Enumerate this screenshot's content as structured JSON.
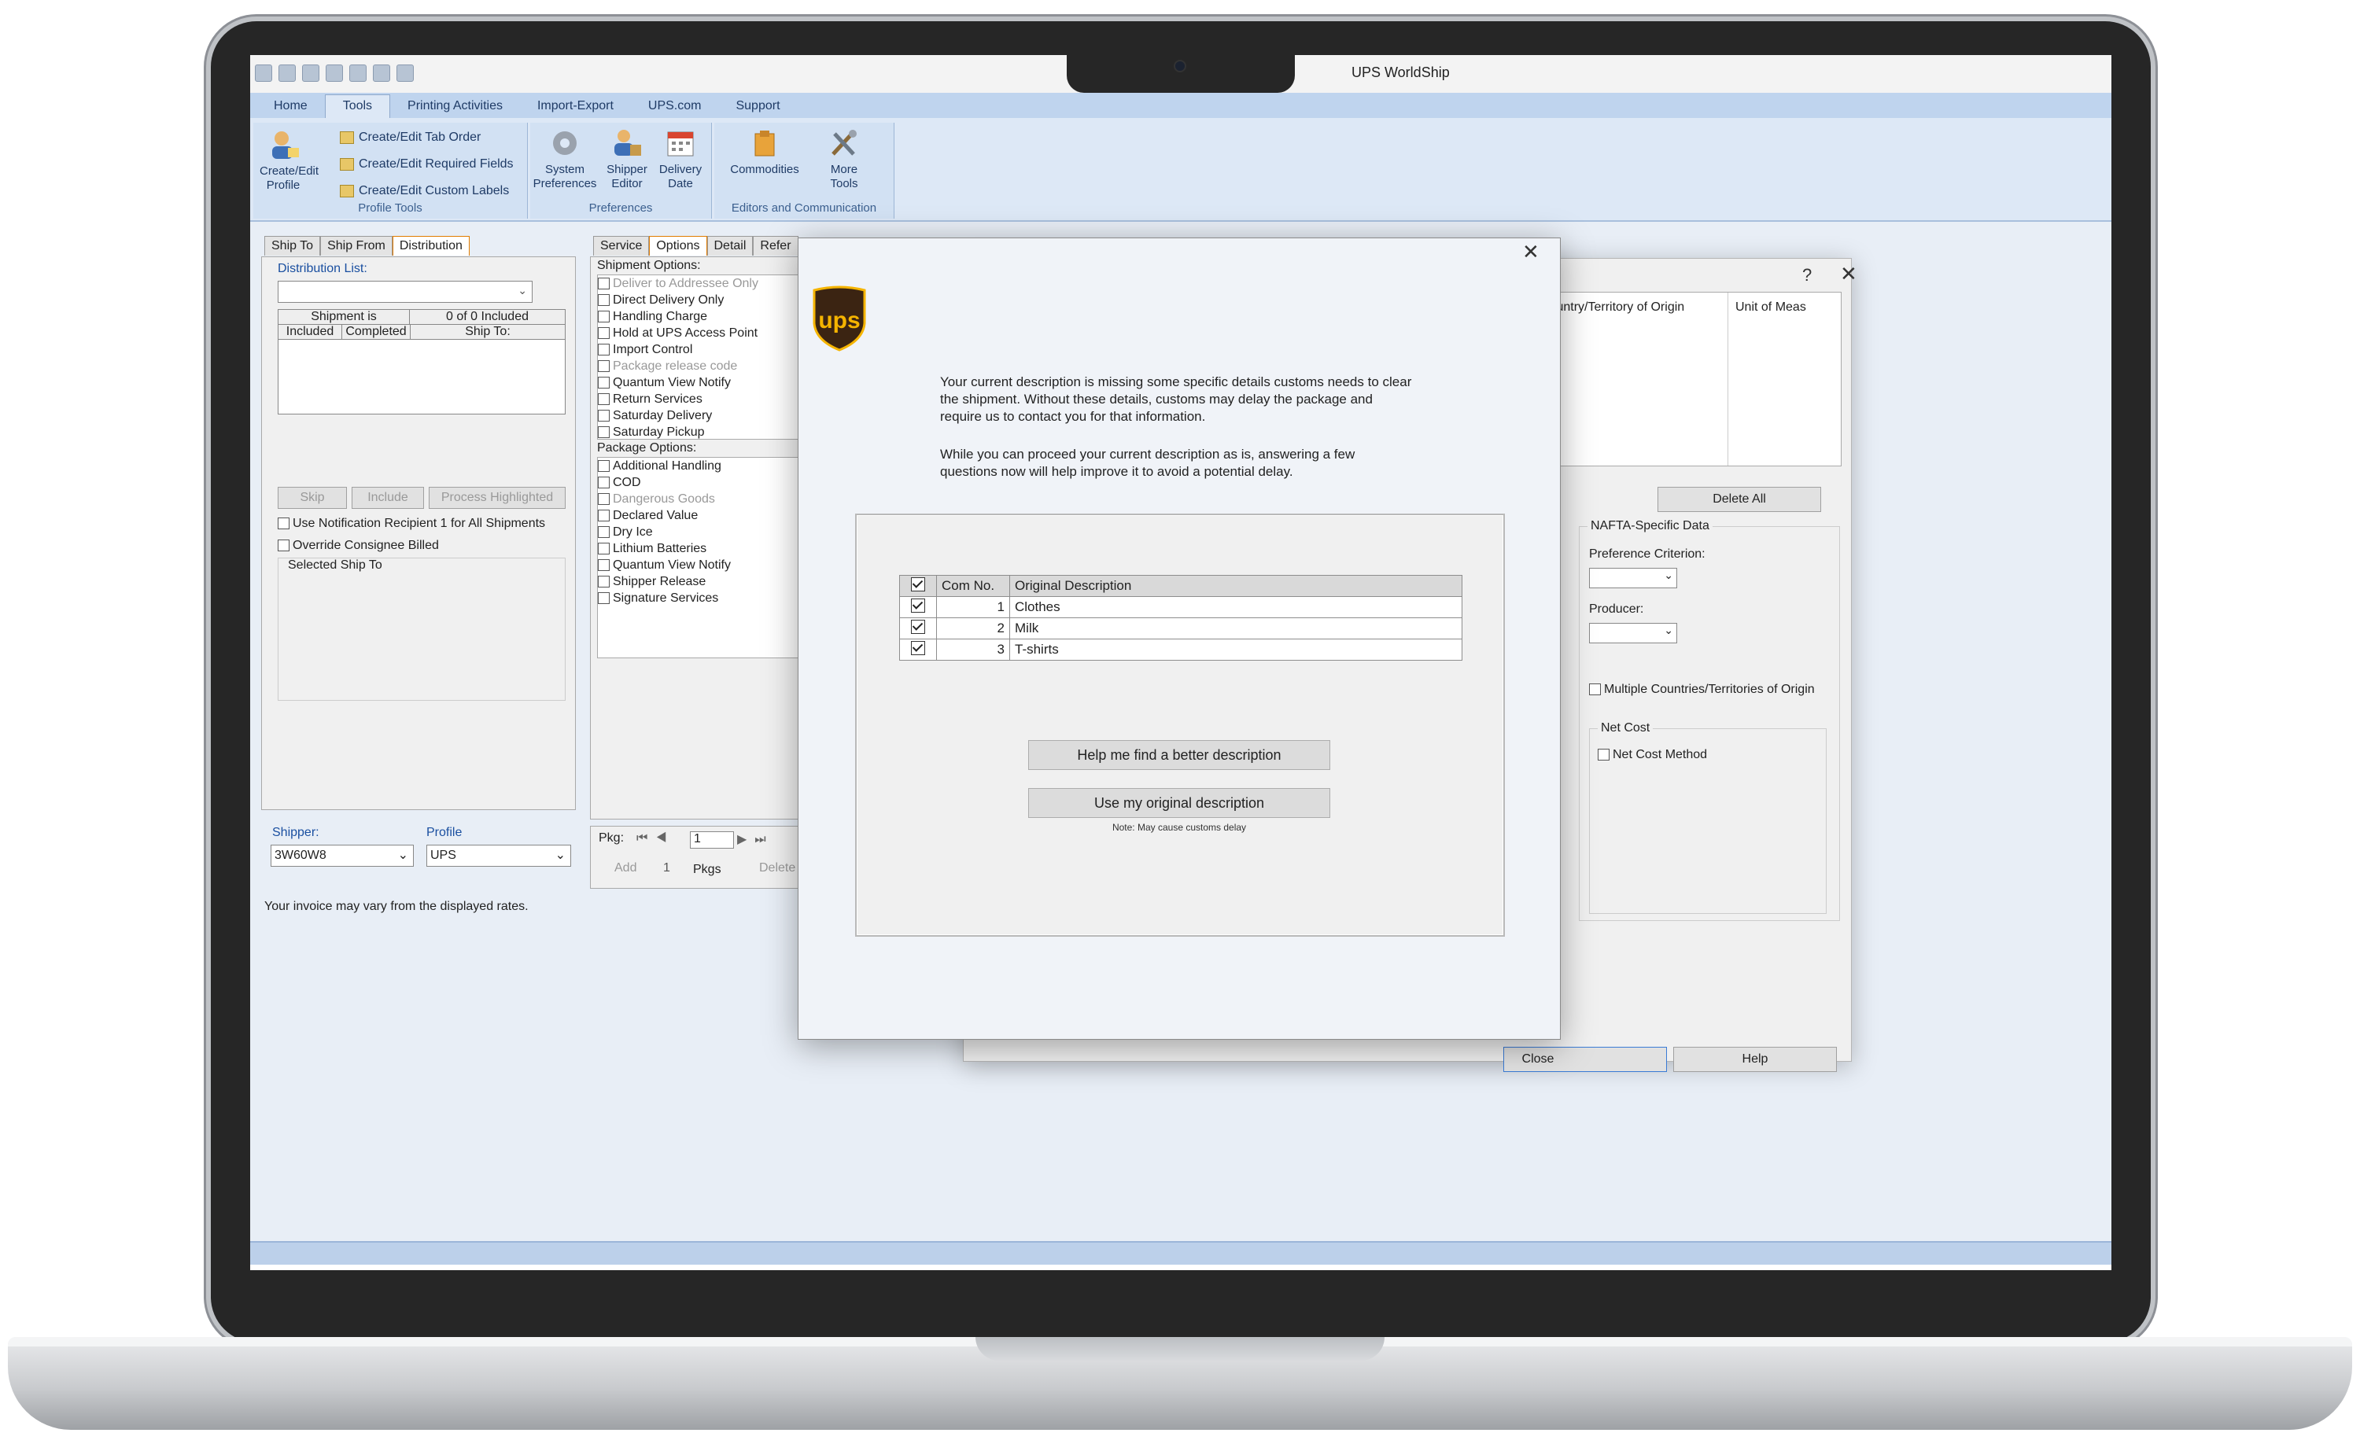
{
  "window": {
    "title": "UPS WorldShip"
  },
  "ribbon": {
    "tabs": [
      "Home",
      "Tools",
      "Printing Activities",
      "Import-Export",
      "UPS.com",
      "Support"
    ],
    "active_tab": "Tools",
    "profile_tools": {
      "create_edit_profile": "Create/Edit Profile",
      "cmd_tab_order": "Create/Edit Tab Order",
      "cmd_required_fields": "Create/Edit Required Fields",
      "cmd_custom_labels": "Create/Edit Custom Labels",
      "group_label": "Profile Tools"
    },
    "preferences": {
      "system_preferences": "System Preferences",
      "shipper_editor": "Shipper Editor",
      "delivery_date": "Delivery Date",
      "group_label": "Preferences"
    },
    "editors": {
      "commodities": "Commodities",
      "more_tools": "More Tools",
      "group_label": "Editors and Communication"
    }
  },
  "left_panel": {
    "tabs": [
      "Ship To",
      "Ship From",
      "Distribution"
    ],
    "distribution_list_label": "Distribution List:",
    "shipment_is": "Shipment is",
    "included_count": "0 of 0 Included",
    "col_included": "Included",
    "col_completed": "Completed",
    "col_ship_to": "Ship To:",
    "btn_skip": "Skip",
    "btn_include": "Include",
    "btn_process": "Process Highlighted",
    "chk_notification": "Use Notification Recipient 1 for All Shipments",
    "chk_override": "Override Consignee Billed",
    "selected_ship_to": "Selected Ship To",
    "shipper_label": "Shipper:",
    "shipper_value": "3W60W8",
    "profile_label": "Profile",
    "profile_value": "UPS",
    "invoice_note": "Your invoice may vary from the displayed rates."
  },
  "options_panel": {
    "tabs": [
      "Service",
      "Options",
      "Detail",
      "Refer"
    ],
    "shipment_options_label": "Shipment Options:",
    "shipment_options": [
      "Deliver to Addressee Only",
      "Direct Delivery Only",
      "Handling Charge",
      "Hold at UPS Access Point",
      "Import Control",
      "Package release code",
      "Quantum View Notify",
      "Return Services",
      "Saturday Delivery",
      "Saturday Pickup"
    ],
    "package_options_label": "Package Options:",
    "package_options": [
      "Additional Handling",
      "COD",
      "Dangerous Goods",
      "Declared Value",
      "Dry Ice",
      "Lithium Batteries",
      "Quantum View Notify",
      "Shipper Release",
      "Signature Services"
    ],
    "pkg_label": "Pkg:",
    "pkg_value": "1",
    "add": "Add",
    "pkgs_count": "1",
    "pkgs": "Pkgs",
    "delete": "Delete"
  },
  "back_dialog": {
    "help_glyph": "?",
    "col_country": "Country/Territory of Origin",
    "col_unit": "Unit of Meas",
    "delete_all": "Delete All",
    "nafta_label": "NAFTA-Specific Data",
    "preference_criterion": "Preference Criterion:",
    "producer": "Producer:",
    "multiple_countries": "Multiple Countries/Territories of Origin",
    "net_cost_group": "Net Cost",
    "net_cost_method": "Net Cost Method",
    "close": "Close",
    "help": "Help"
  },
  "modal": {
    "logo_text": "ups",
    "message_1": "Your current description is missing some specific details customs needs to clear the shipment. Without these details, customs may delay the package and require us to contact you for that information.",
    "message_2": "While you can proceed your current description as is, answering a few questions now will help improve it to avoid a potential delay.",
    "table_headers": [
      "Com No.",
      "Original Description"
    ],
    "rows": [
      {
        "no": "1",
        "desc": "Clothes"
      },
      {
        "no": "2",
        "desc": "Milk"
      },
      {
        "no": "3",
        "desc": "T-shirts"
      }
    ],
    "btn_better": "Help me find a better description",
    "btn_original": "Use my original description",
    "note": "Note: May cause customs delay"
  },
  "colors": {
    "ribbon": "#dde8f6",
    "tabs": "#bfd4ee",
    "ups_brown": "#3b2412",
    "ups_gold": "#f5b400"
  }
}
